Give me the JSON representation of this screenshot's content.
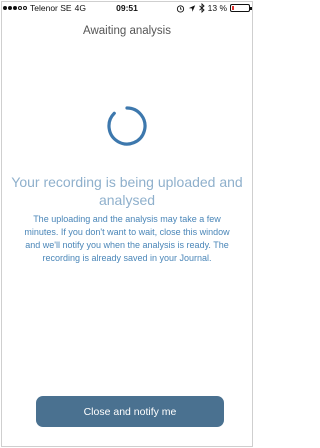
{
  "status_bar": {
    "carrier": "Telenor SE",
    "network": "4G",
    "time": "09:51",
    "battery": "13 %",
    "battery_level": 0.13,
    "battery_color": "#e0322f"
  },
  "header": {
    "title": "Awaiting analysis"
  },
  "main": {
    "headline": "Your recording is being uploaded and analysed",
    "body": "The uploading and the analysis may take a few minutes. If you don't want to wait, close this window and we'll notify you when the analysis is ready. The recording is already saved in your Journal.",
    "spinner_color": "#3d78ad",
    "headline_color": "#8fb0cc",
    "body_color": "#4a86b8"
  },
  "footer": {
    "close_button_label": "Close and notify me",
    "button_color": "#4a7190"
  }
}
